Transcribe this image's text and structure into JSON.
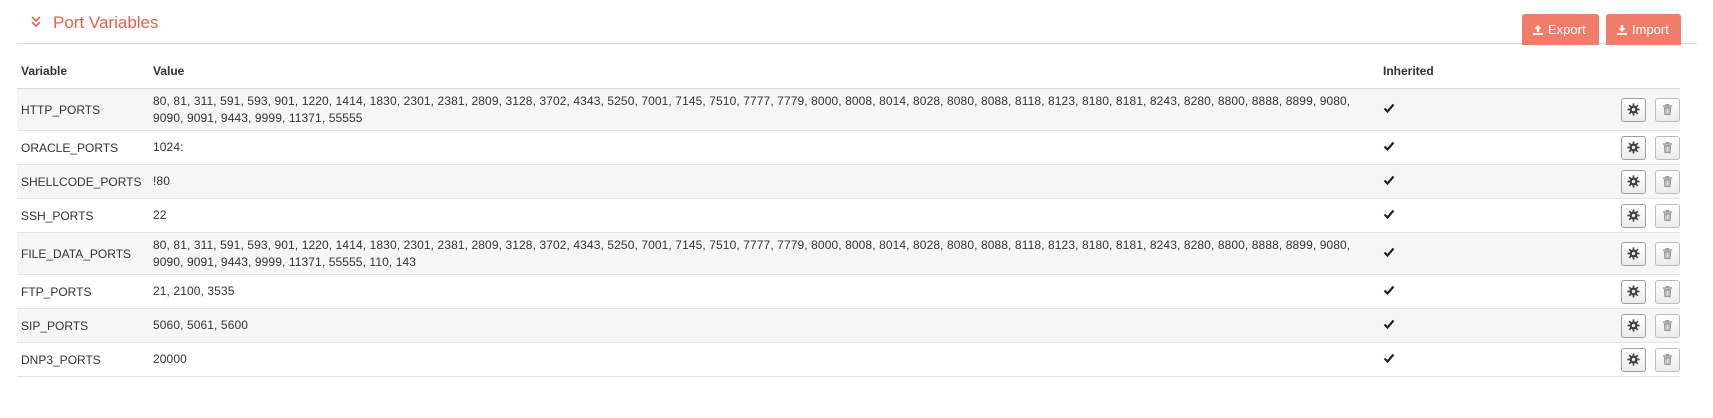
{
  "panel": {
    "title": "Port Variables",
    "export_label": "Export",
    "import_label": "Import",
    "accent_color": "#e8604c",
    "button_color": "#ef7d6a"
  },
  "table": {
    "headers": {
      "variable": "Variable",
      "value": "Value",
      "inherited": "Inherited"
    },
    "rows": [
      {
        "variable": "HTTP_PORTS",
        "value": "80, 81, 311, 591, 593, 901, 1220, 1414, 1830, 2301, 2381, 2809, 3128, 3702, 4343, 5250, 7001, 7145, 7510, 7777, 7779, 8000, 8008, 8014, 8028, 8080, 8088, 8118, 8123, 8180, 8181, 8243, 8280, 8800, 8888, 8899, 9080, 9090, 9091, 9443, 9999, 11371, 55555",
        "inherited": true
      },
      {
        "variable": "ORACLE_PORTS",
        "value": "1024:",
        "inherited": true
      },
      {
        "variable": "SHELLCODE_PORTS",
        "value": "!80",
        "inherited": true
      },
      {
        "variable": "SSH_PORTS",
        "value": "22",
        "inherited": true
      },
      {
        "variable": "FILE_DATA_PORTS",
        "value": "80, 81, 311, 591, 593, 901, 1220, 1414, 1830, 2301, 2381, 2809, 3128, 3702, 4343, 5250, 7001, 7145, 7510, 7777, 7779, 8000, 8008, 8014, 8028, 8080, 8088, 8118, 8123, 8180, 8181, 8243, 8280, 8800, 8888, 8899, 9080, 9090, 9091, 9443, 9999, 11371, 55555, 110, 143",
        "inherited": true
      },
      {
        "variable": "FTP_PORTS",
        "value": "21, 2100, 3535",
        "inherited": true
      },
      {
        "variable": "SIP_PORTS",
        "value": "5060, 5061, 5600",
        "inherited": true
      },
      {
        "variable": "DNP3_PORTS",
        "value": "20000",
        "inherited": true
      }
    ]
  },
  "icons": {
    "collapse": "double-chevron-down-icon",
    "export": "upload-icon",
    "import": "download-icon",
    "inherited": "check-icon",
    "edit": "gear-icon",
    "delete": "trash-icon"
  }
}
